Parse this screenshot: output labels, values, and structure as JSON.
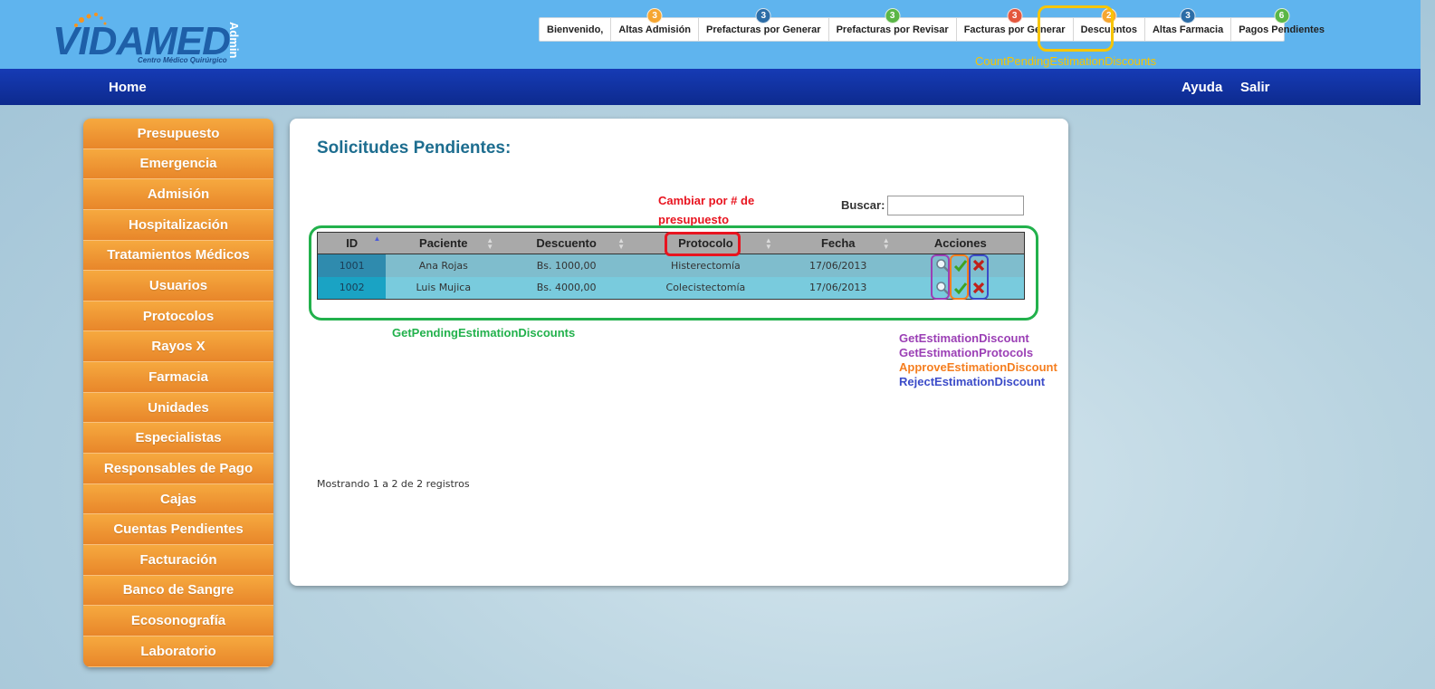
{
  "brand": {
    "logo_text": "VIDAMED",
    "subtitle": "Centro Médico Quirúrgico",
    "role": "Admin"
  },
  "top_tabs": [
    {
      "label": "Bienvenido,",
      "badge": "",
      "badge_color": ""
    },
    {
      "label": "Altas Admisión",
      "badge": "3",
      "badge_color": "#f6a631"
    },
    {
      "label": "Prefacturas por Generar",
      "badge": "3",
      "badge_color": "#2c6da7"
    },
    {
      "label": "Prefacturas por Revisar",
      "badge": "3",
      "badge_color": "#5ab646"
    },
    {
      "label": "Facturas por Generar",
      "badge": "3",
      "badge_color": "#e4573d"
    },
    {
      "label": "Descuentos",
      "badge": "2",
      "badge_color": "#f6a631"
    },
    {
      "label": "Altas Farmacia",
      "badge": "3",
      "badge_color": "#2c6da7"
    },
    {
      "label": "Pagos Pendientes",
      "badge": "6",
      "badge_color": "#5ab646"
    }
  ],
  "navbar": {
    "home": "Home",
    "help": "Ayuda",
    "logout": "Salir"
  },
  "sidebar": [
    "Presupuesto",
    "Emergencia",
    "Admisión",
    "Hospitalización",
    "Tratamientos Médicos",
    "Usuarios",
    "Protocolos",
    "Rayos X",
    "Farmacia",
    "Unidades",
    "Especialistas",
    "Responsables de Pago",
    "Cajas",
    "Cuentas Pendientes",
    "Facturación",
    "Banco de Sangre",
    "Ecosonografía",
    "Laboratorio"
  ],
  "main": {
    "title": "Solicitudes Pendientes:",
    "search_label": "Buscar:",
    "search_value": "",
    "columns": [
      "ID",
      "Paciente",
      "Descuento",
      "Protocolo",
      "Fecha",
      "Acciones"
    ],
    "rows": [
      {
        "id": "1001",
        "paciente": "Ana Rojas",
        "descuento": "Bs. 1000,00",
        "protocolo": "Histerectomía",
        "fecha": "17/06/2013"
      },
      {
        "id": "1002",
        "paciente": "Luis Mujica",
        "descuento": "Bs. 4000,00",
        "protocolo": "Colecistectomía",
        "fecha": "17/06/2013"
      }
    ],
    "info": "Mostrando 1 a 2 de 2 registros"
  },
  "annotations": {
    "count_pending": "CountPendingEstimationDiscounts",
    "change_note_line1": "Cambiar por # de",
    "change_note_line2": "presupuesto",
    "get_pending": "GetPendingEstimationDiscounts",
    "get_discount": "GetEstimationDiscount",
    "get_protocols": "GetEstimationProtocols",
    "approve": "ApproveEstimationDiscount",
    "reject": "RejectEstimationDiscount"
  },
  "colors": {
    "annotation_yellow": "#f7c500",
    "annotation_red": "#e8141f",
    "annotation_green": "#22b14c",
    "annotation_purple": "#9b3fb5",
    "annotation_orange": "#f57e1f",
    "annotation_blue": "#3b4bc8"
  }
}
